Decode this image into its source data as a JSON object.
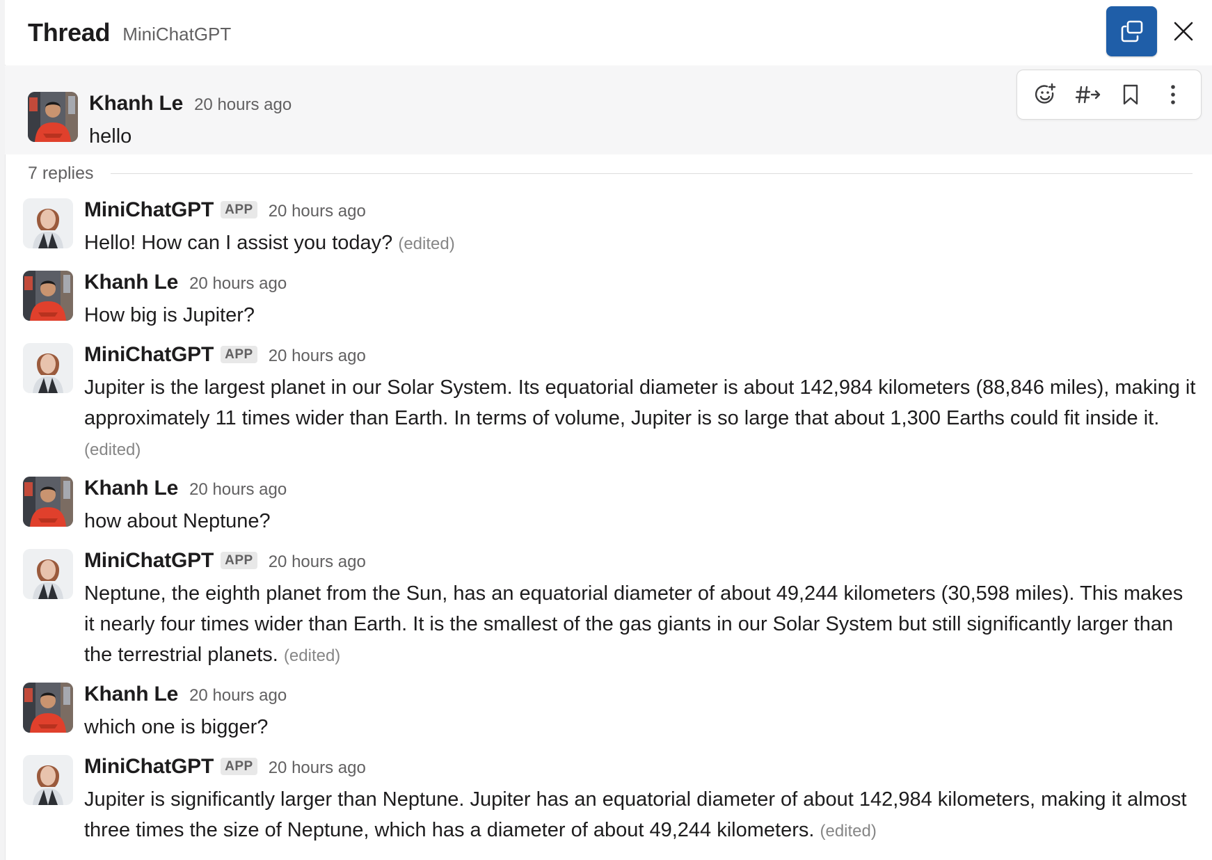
{
  "header": {
    "title": "Thread",
    "channel": "MiniChatGPT"
  },
  "parent_message": {
    "author": "Khanh Le",
    "time": "20 hours ago",
    "text": "hello"
  },
  "replies_label": "7 replies",
  "app_badge": "APP",
  "edited_label": "(edited)",
  "replies": [
    {
      "author": "MiniChatGPT",
      "time": "20 hours ago",
      "text": "Hello! How can I assist you today?"
    },
    {
      "author": "Khanh Le",
      "time": "20 hours ago",
      "text": "How big is Jupiter?"
    },
    {
      "author": "MiniChatGPT",
      "time": "20 hours ago",
      "text": "Jupiter is the largest planet in our Solar System. Its equatorial diameter is about 142,984 kilometers (88,846 miles), making it approximately 11 times wider than Earth. In terms of volume, Jupiter is so large that about 1,300 Earths could fit inside it."
    },
    {
      "author": "Khanh Le",
      "time": "20 hours ago",
      "text": "how about Neptune?"
    },
    {
      "author": "MiniChatGPT",
      "time": "20 hours ago",
      "text": "Neptune, the eighth planet from the Sun, has an equatorial diameter of about 49,244 kilometers (30,598 miles). This makes it nearly four times wider than Earth. It is the smallest of the gas giants in our Solar System but still significantly larger than the terrestrial planets."
    },
    {
      "author": "Khanh Le",
      "time": "20 hours ago",
      "text": "which one is bigger?"
    },
    {
      "author": "MiniChatGPT",
      "time": "20 hours ago",
      "text": "Jupiter is significantly larger than Neptune. Jupiter has an equatorial diameter of about 142,984 kilometers, making it almost three times the size of Neptune, which has a diameter of about 49,244 kilometers."
    }
  ],
  "icons": {
    "open": "open-in-window-icon",
    "close": "close-icon",
    "reaction": "add-reaction-icon",
    "share": "share-to-channel-icon",
    "save": "bookmark-icon",
    "more": "more-actions-icon"
  },
  "colors": {
    "accent_button": "#1f5ea8",
    "parent_highlight": "#f6f6f7"
  }
}
